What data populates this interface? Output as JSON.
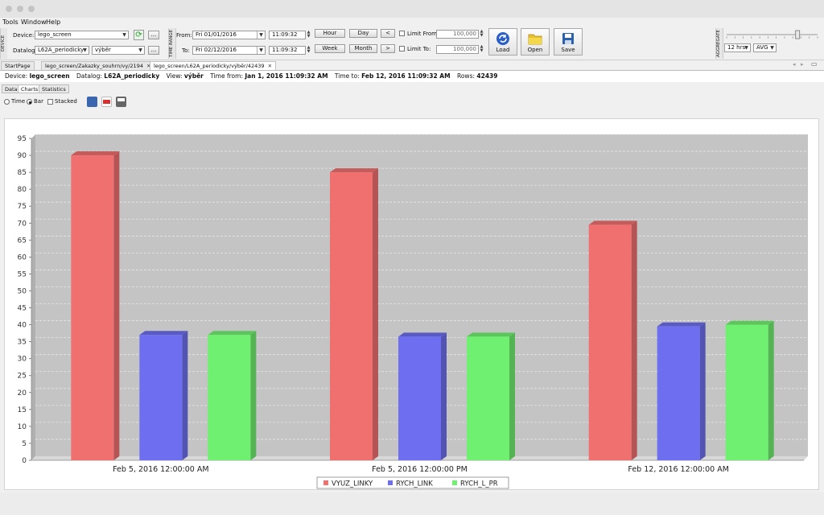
{
  "menu": [
    "Tools",
    "Window",
    "Help"
  ],
  "toolbar": {
    "device_section": "DEVICE",
    "device_label": "Device:",
    "device_value": "lego_screen",
    "datalog_label": "Datalog:",
    "datalog_value": "L62A_periodicky",
    "view_value": "výběr",
    "more_label": "...",
    "time_section": "TIME RANGE",
    "from_label": "From:",
    "from_date": "Fri 01/01/2016",
    "from_time": "11:09:32",
    "to_label": "To:",
    "to_date": "Fri 02/12/2016",
    "to_time": "11:09:32",
    "hour": "Hour",
    "day": "Day",
    "week": "Week",
    "month": "Month",
    "prev": "<",
    "next": ">",
    "limit_from_label": "Limit From:",
    "limit_from_value": "100,000",
    "limit_to_label": "Limit To:",
    "limit_to_value": "100,000",
    "load": "Load",
    "open": "Open",
    "save": "Save",
    "aggregate_section": "AGGREGATE",
    "agg_period": "12 hrs",
    "agg_func": "AVG",
    "slider_level": 0.78
  },
  "tabs": [
    {
      "label": "StartPage",
      "closable": false
    },
    {
      "label": "lego_screen/Zakazky_souhrn/vy/2194",
      "closable": true
    },
    {
      "label": "lego_screen/L62A_periodicky/výběr/42439",
      "closable": true
    }
  ],
  "info": {
    "device_label": "Device:",
    "device": "lego_screen",
    "datalog_label": "Datalog:",
    "datalog": "L62A_periodicky",
    "view_label": "View:",
    "view": "výběr",
    "from_label": "Time from:",
    "from": "Jan 1, 2016 11:09:32 AM",
    "to_label": "Time to:",
    "to": "Feb 12, 2016 11:09:32 AM",
    "rows_label": "Rows:",
    "rows": "42439"
  },
  "subtabs": [
    "Data",
    "Charts",
    "Statistics"
  ],
  "chart_options": {
    "time": "Time",
    "bar": "Bar",
    "stacked": "Stacked",
    "selected": "Bar"
  },
  "colors": {
    "series1": "#f07070",
    "series2": "#6e6ef0",
    "series3": "#70f070",
    "plot_bg": "#c4c4c4"
  },
  "chart_data": {
    "type": "bar",
    "categories": [
      "Feb 5, 2016 12:00:00 AM",
      "Feb 5, 2016 12:00:00 PM",
      "Feb 12, 2016 12:00:00 AM"
    ],
    "series": [
      {
        "name": "VYUZ_LINKY",
        "values": [
          90,
          85,
          69.5
        ]
      },
      {
        "name": "RYCH_LINK",
        "values": [
          37,
          36.5,
          39.5
        ]
      },
      {
        "name": "RYCH_L_PR",
        "values": [
          37,
          36.5,
          40
        ]
      }
    ],
    "ylim": [
      0,
      95
    ],
    "yticks": [
      0,
      5,
      10,
      15,
      20,
      25,
      30,
      35,
      40,
      45,
      50,
      55,
      60,
      65,
      70,
      75,
      80,
      85,
      90,
      95
    ],
    "grid": true,
    "legend": "bottom-center",
    "style": "3d"
  }
}
